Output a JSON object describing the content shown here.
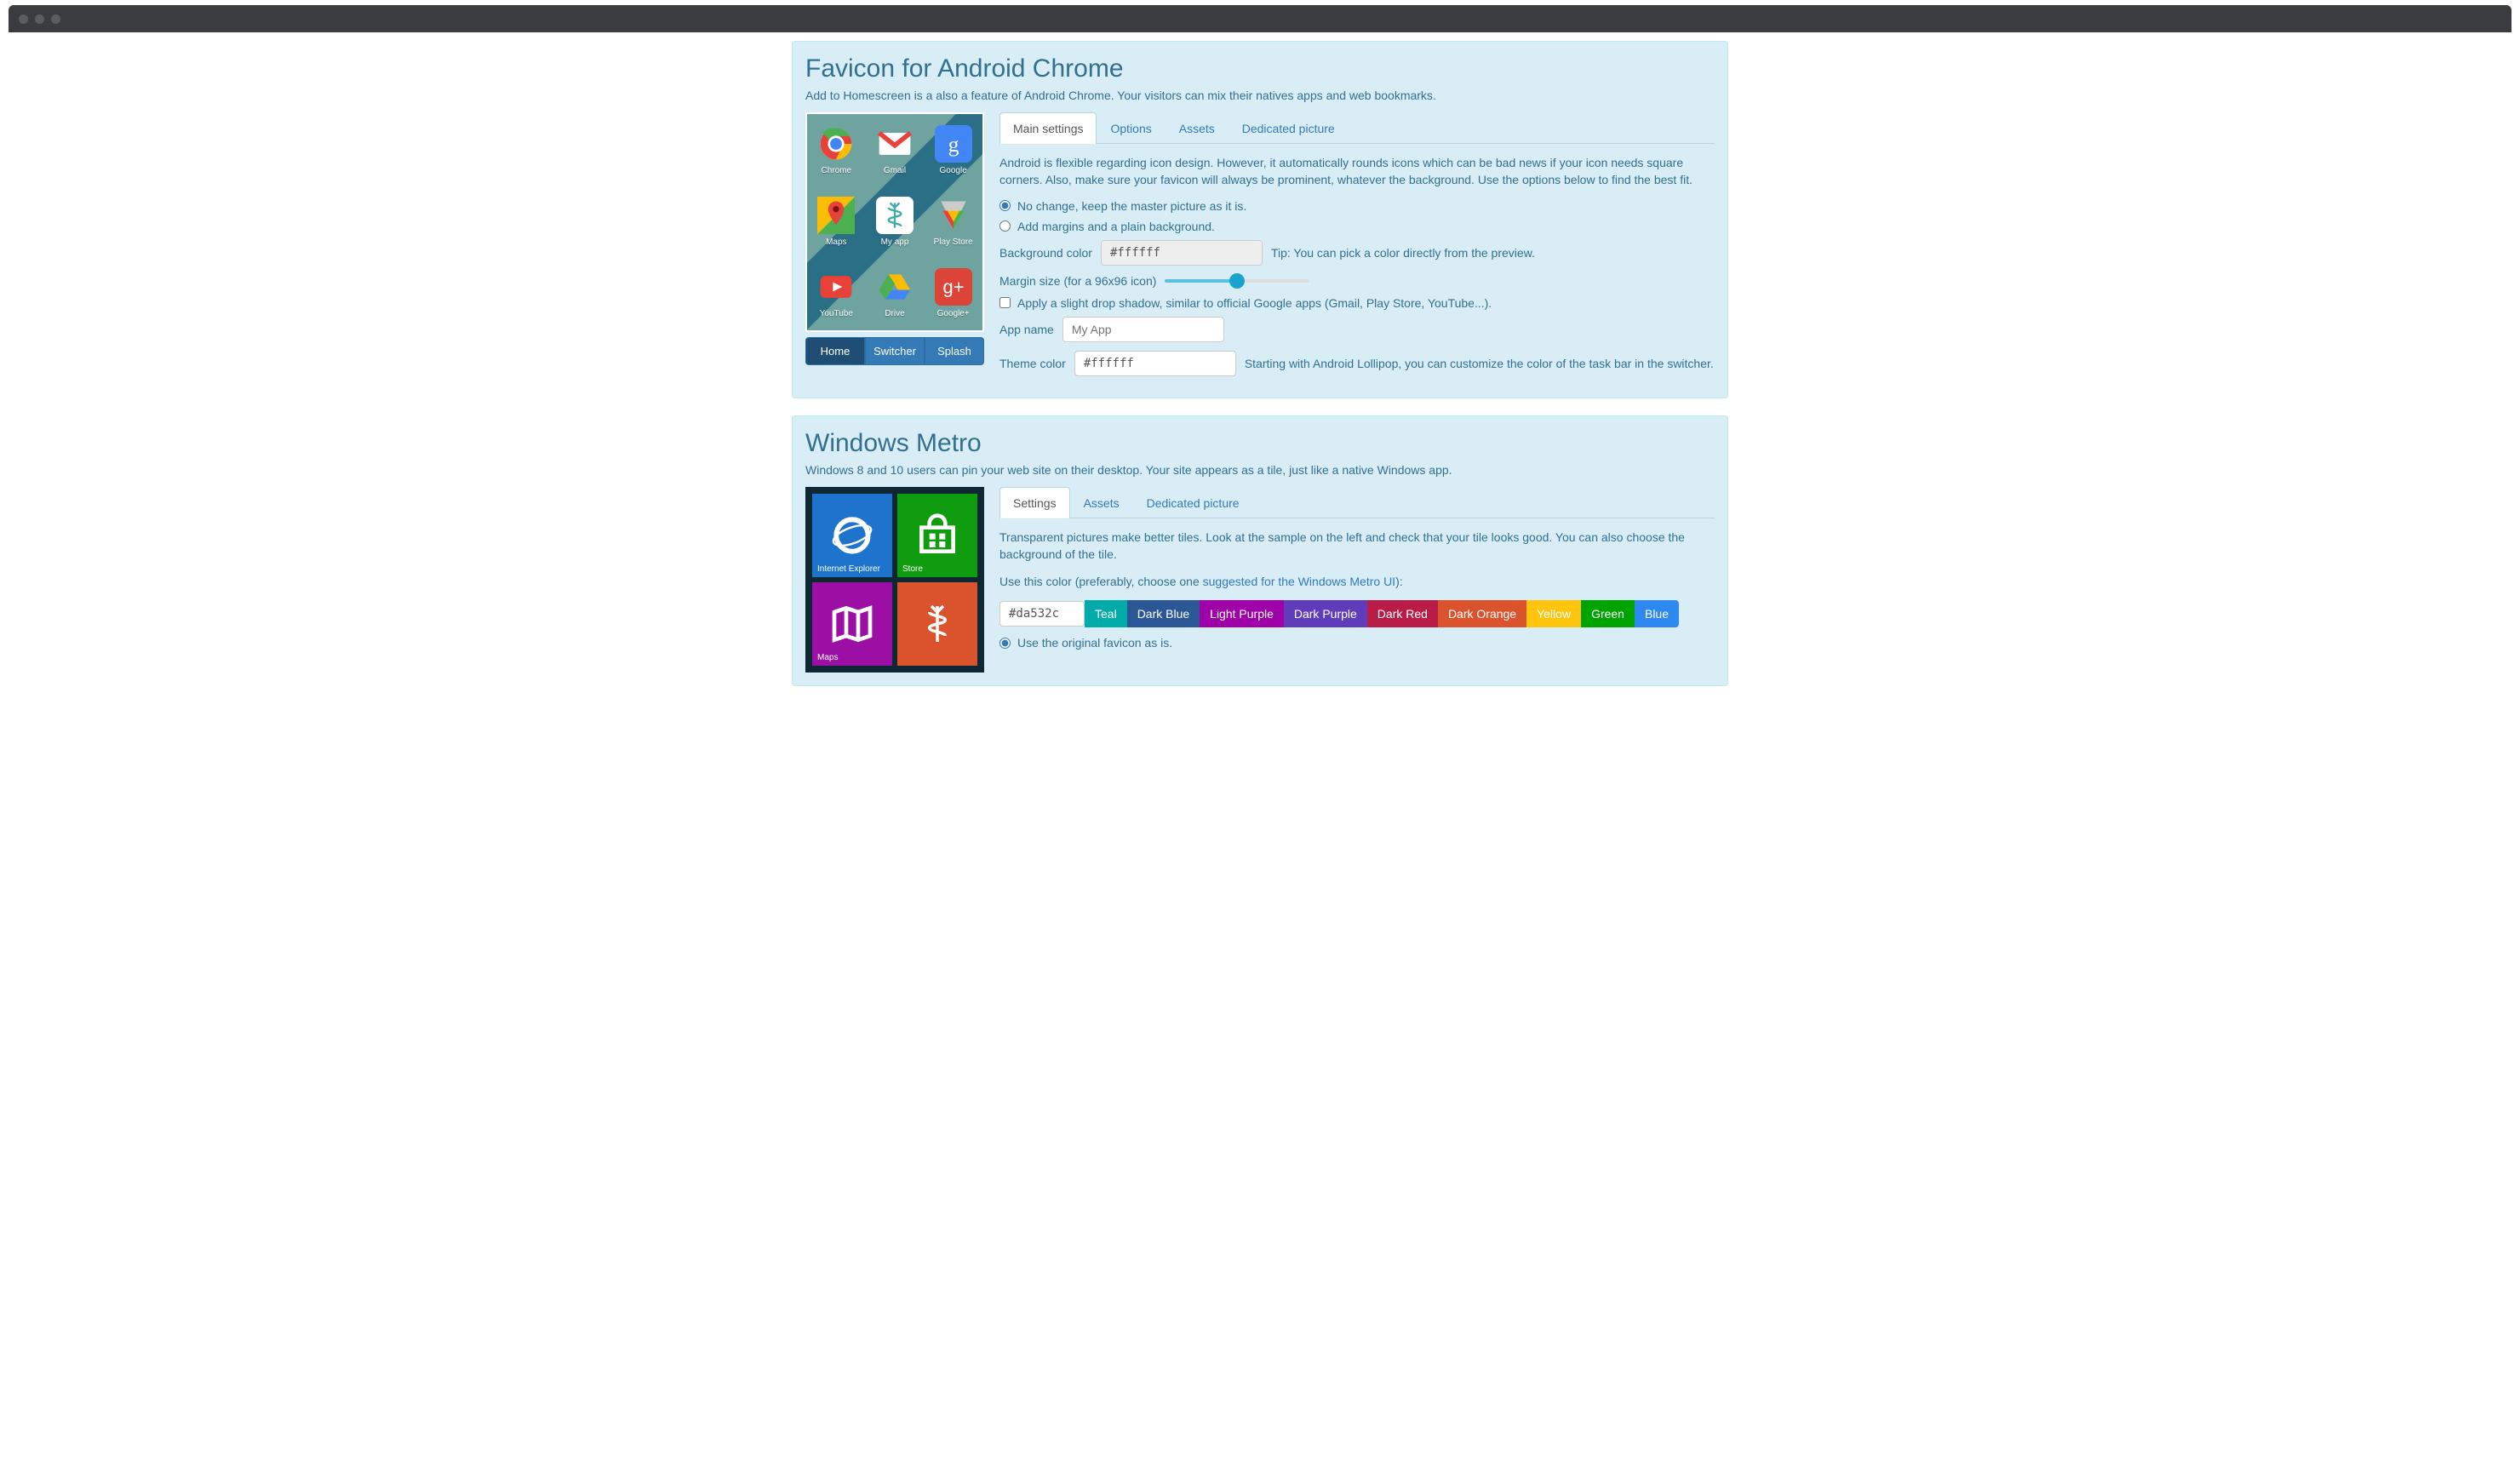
{
  "android": {
    "title": "Favicon for Android Chrome",
    "desc": "Add to Homescreen is a also a feature of Android Chrome. Your visitors can mix their natives apps and web bookmarks.",
    "preview_icons": [
      "Chrome",
      "Gmail",
      "Google",
      "Maps",
      "My app",
      "Play Store",
      "YouTube",
      "Drive",
      "Google+"
    ],
    "preview_buttons": {
      "home": "Home",
      "switcher": "Switcher",
      "splash": "Splash"
    },
    "tabs": {
      "main": "Main settings",
      "options": "Options",
      "assets": "Assets",
      "dedicated": "Dedicated picture"
    },
    "intro": "Android is flexible regarding icon design. However, it automatically rounds icons which can be bad news if your icon needs square corners. Also, make sure your favicon will always be prominent, whatever the background. Use the options below to find the best fit.",
    "radio_nochange": "No change, keep the master picture as it is.",
    "radio_margins": "Add margins and a plain background.",
    "bg_label": "Background color",
    "bg_value": "#ffffff",
    "bg_tip": "Tip: You can pick a color directly from the preview.",
    "margin_label": "Margin size (for a 96x96 icon)",
    "shadow_label": "Apply a slight drop shadow, similar to official Google apps (Gmail, Play Store, YouTube...).",
    "appname_label": "App name",
    "appname_placeholder": "My App",
    "theme_label": "Theme color",
    "theme_value": "#ffffff",
    "theme_tip": "Starting with Android Lollipop, you can customize the color of the task bar in the switcher."
  },
  "metro": {
    "title": "Windows Metro",
    "desc": "Windows 8 and 10 users can pin your web site on their desktop. Your site appears as a tile, just like a native Windows app.",
    "tiles": {
      "ie": "Internet Explorer",
      "store": "Store",
      "maps": "Maps"
    },
    "tabs": {
      "settings": "Settings",
      "assets": "Assets",
      "dedicated": "Dedicated picture"
    },
    "intro": "Transparent pictures make better tiles. Look at the sample on the left and check that your tile looks good. You can also choose the background of the tile.",
    "color_prefix": "Use this color (preferably, choose one ",
    "color_link": "suggested for the Windows Metro UI",
    "color_suffix": "):",
    "color_value": "#da532c",
    "colors": [
      {
        "label": "Teal",
        "hex": "#00aba9"
      },
      {
        "label": "Dark Blue",
        "hex": "#2b5797"
      },
      {
        "label": "Light Purple",
        "hex": "#9f00a7"
      },
      {
        "label": "Dark Purple",
        "hex": "#603cba"
      },
      {
        "label": "Dark Red",
        "hex": "#b91d47"
      },
      {
        "label": "Dark Orange",
        "hex": "#da532c"
      },
      {
        "label": "Yellow",
        "hex": "#ffc40d"
      },
      {
        "label": "Green",
        "hex": "#00a300"
      },
      {
        "label": "Blue",
        "hex": "#2d89ef"
      }
    ],
    "radio_original": "Use the original favicon as is."
  }
}
